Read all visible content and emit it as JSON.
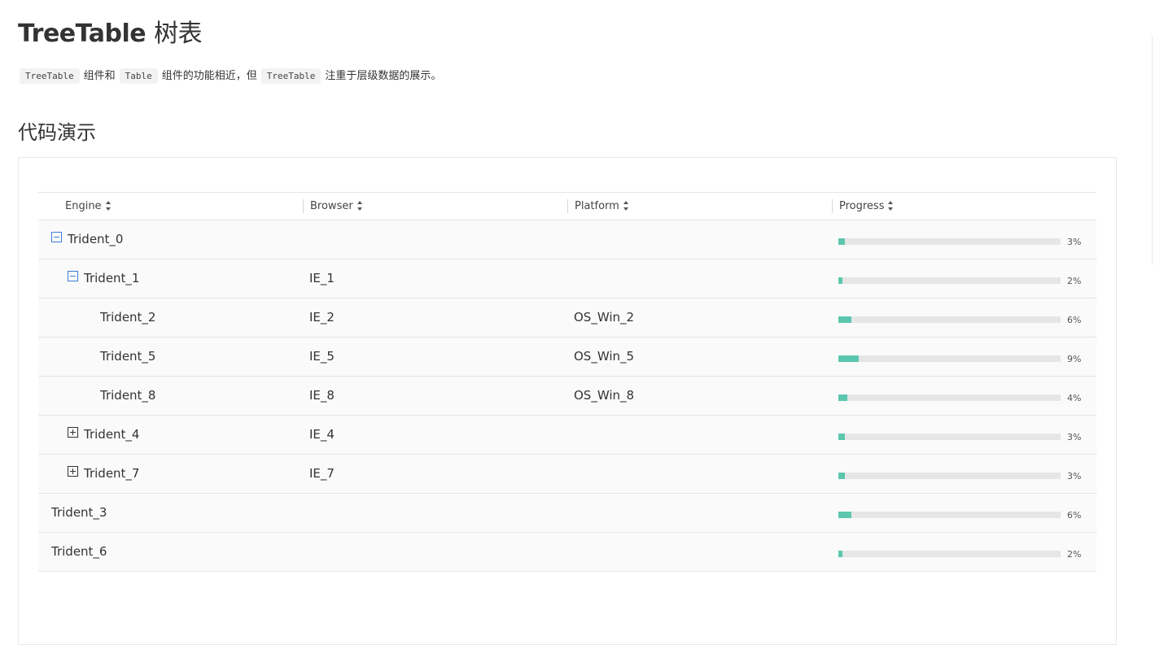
{
  "page": {
    "title_en": "TreeTable",
    "title_cn": "树表",
    "desc": {
      "code1": "TreeTable",
      "text1": "组件和",
      "code2": "Table",
      "text2": "组件的功能相近，但",
      "code3": "TreeTable",
      "text3": "注重于层级数据的展示。"
    },
    "section_title": "代码演示"
  },
  "table": {
    "headers": {
      "engine": "Engine",
      "browser": "Browser",
      "platform": "Platform",
      "progress": "Progress"
    },
    "rows": [
      {
        "engine": "Trident_0",
        "browser": "",
        "platform": "",
        "progress": 3,
        "progress_label": "3%",
        "level": 0,
        "toggle": "expanded"
      },
      {
        "engine": "Trident_1",
        "browser": "IE_1",
        "platform": "",
        "progress": 2,
        "progress_label": "2%",
        "level": 1,
        "toggle": "expanded"
      },
      {
        "engine": "Trident_2",
        "browser": "IE_2",
        "platform": "OS_Win_2",
        "progress": 6,
        "progress_label": "6%",
        "level": 2,
        "toggle": "none"
      },
      {
        "engine": "Trident_5",
        "browser": "IE_5",
        "platform": "OS_Win_5",
        "progress": 9,
        "progress_label": "9%",
        "level": 2,
        "toggle": "none"
      },
      {
        "engine": "Trident_8",
        "browser": "IE_8",
        "platform": "OS_Win_8",
        "progress": 4,
        "progress_label": "4%",
        "level": 2,
        "toggle": "none"
      },
      {
        "engine": "Trident_4",
        "browser": "IE_4",
        "platform": "",
        "progress": 3,
        "progress_label": "3%",
        "level": 1,
        "toggle": "collapsed"
      },
      {
        "engine": "Trident_7",
        "browser": "IE_7",
        "platform": "",
        "progress": 3,
        "progress_label": "3%",
        "level": 1,
        "toggle": "collapsed"
      },
      {
        "engine": "Trident_3",
        "browser": "",
        "platform": "",
        "progress": 6,
        "progress_label": "6%",
        "level": 0,
        "toggle": "none"
      },
      {
        "engine": "Trident_6",
        "browser": "",
        "platform": "",
        "progress": 2,
        "progress_label": "2%",
        "level": 0,
        "toggle": "none"
      }
    ],
    "progress_color": "#5cc7ae",
    "progress_track_color": "#e6e6e6",
    "expanded_toggle_color": "#3a7dd4"
  }
}
